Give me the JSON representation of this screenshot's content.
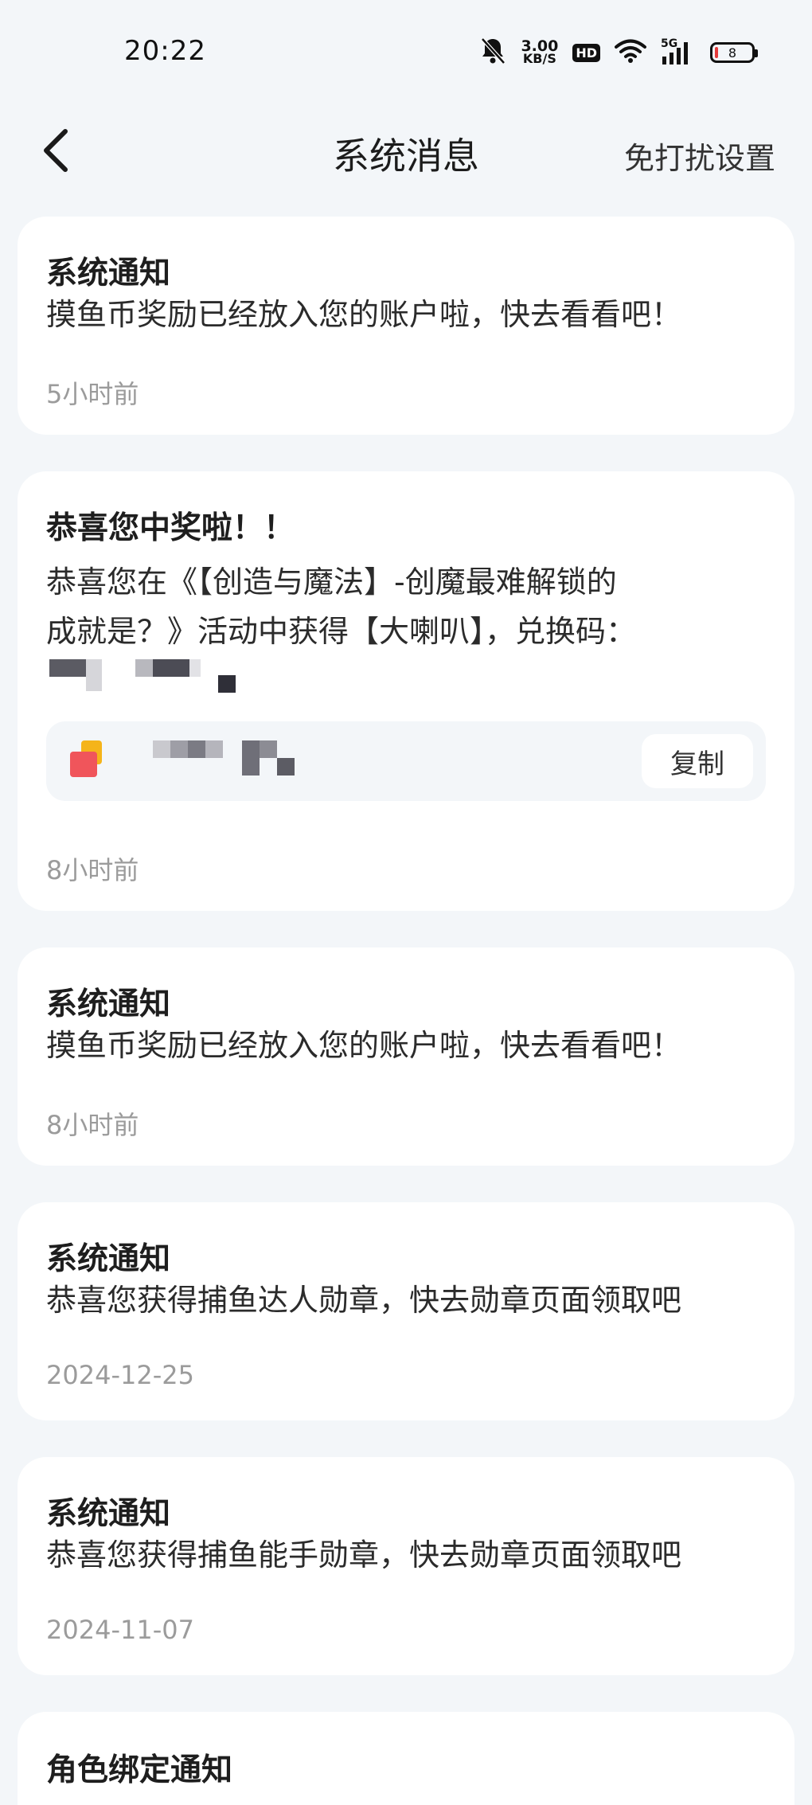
{
  "status_bar": {
    "time": "20:22",
    "net_speed_value": "3.00",
    "net_speed_unit": "KB/S",
    "hd_badge": "HD",
    "network_label": "5G",
    "battery_level": "8"
  },
  "nav": {
    "title": "系统消息",
    "right_action": "免打扰设置"
  },
  "messages": [
    {
      "title": "系统通知",
      "body": "摸鱼币奖励已经放入您的账户啦，快去看看吧！",
      "time": "5小时前"
    },
    {
      "title": "恭喜您中奖啦！！",
      "body_line1": "恭喜您在《【创造与魔法】-创魔最难解锁的",
      "body_line2": "成就是？》活动中获得【大喇叭】，兑换码：",
      "copy_label": "复制",
      "time": "8小时前"
    },
    {
      "title": "系统通知",
      "body": "摸鱼币奖励已经放入您的账户啦，快去看看吧！",
      "time": "8小时前"
    },
    {
      "title": "系统通知",
      "body": "恭喜您获得捕鱼达人勋章，快去勋章页面领取吧",
      "time": "2024-12-25"
    },
    {
      "title": "系统通知",
      "body": "恭喜您获得捕鱼能手勋章，快去勋章页面领取吧",
      "time": "2024-11-07"
    },
    {
      "title": "角色绑定通知"
    }
  ],
  "colors": {
    "background": "#f3f6f9",
    "card": "#ffffff",
    "battery_low": "#e53a3a",
    "muted_text": "#9b9b9b"
  }
}
